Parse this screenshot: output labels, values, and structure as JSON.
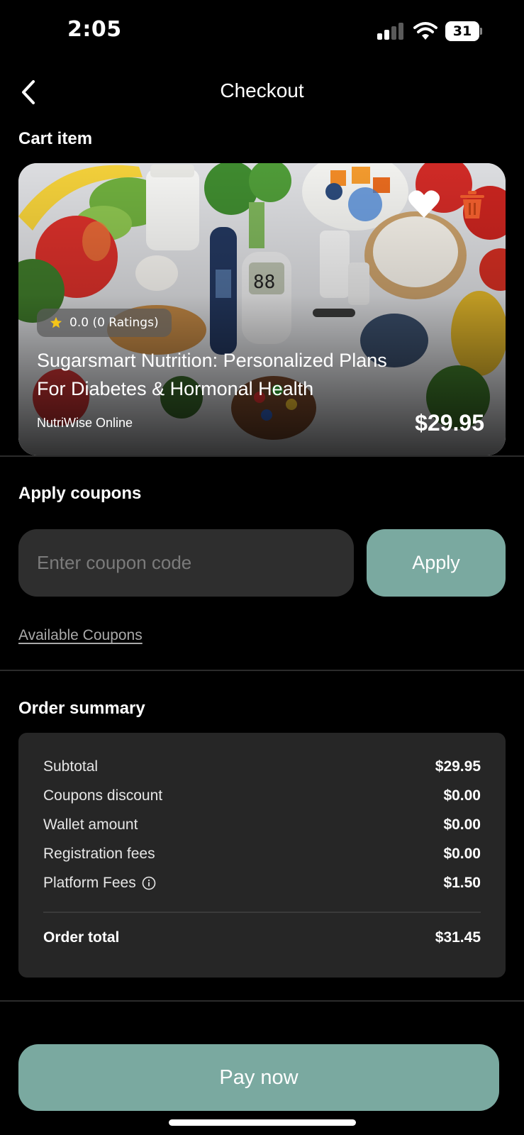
{
  "status_bar": {
    "time": "2:05",
    "battery": "31"
  },
  "header": {
    "title": "Checkout"
  },
  "cart": {
    "section_title": "Cart item",
    "item": {
      "rating_text": "0.0 (0 Ratings)",
      "title": "Sugarsmart Nutrition: Personalized Plans For Diabetes & Hormonal Health",
      "seller": "NutriWise Online",
      "price": "$29.95"
    }
  },
  "coupons": {
    "section_title": "Apply coupons",
    "input_placeholder": "Enter coupon code",
    "input_value": "",
    "apply_label": "Apply",
    "available_label": "Available Coupons"
  },
  "summary": {
    "section_title": "Order summary",
    "rows": [
      {
        "label": "Subtotal",
        "value": "$29.95"
      },
      {
        "label": "Coupons discount",
        "value": "$0.00"
      },
      {
        "label": "Wallet amount",
        "value": "$0.00"
      },
      {
        "label": "Registration fees",
        "value": "$0.00"
      },
      {
        "label": "Platform Fees",
        "value": "$1.50",
        "info_icon": "info-icon"
      }
    ],
    "total": {
      "label": "Order total",
      "value": "$31.45"
    }
  },
  "actions": {
    "pay_label": "Pay now"
  },
  "colors": {
    "accent": "#7aa9a0",
    "background": "#000000",
    "panel": "#262626",
    "input": "#2e2e2e"
  }
}
